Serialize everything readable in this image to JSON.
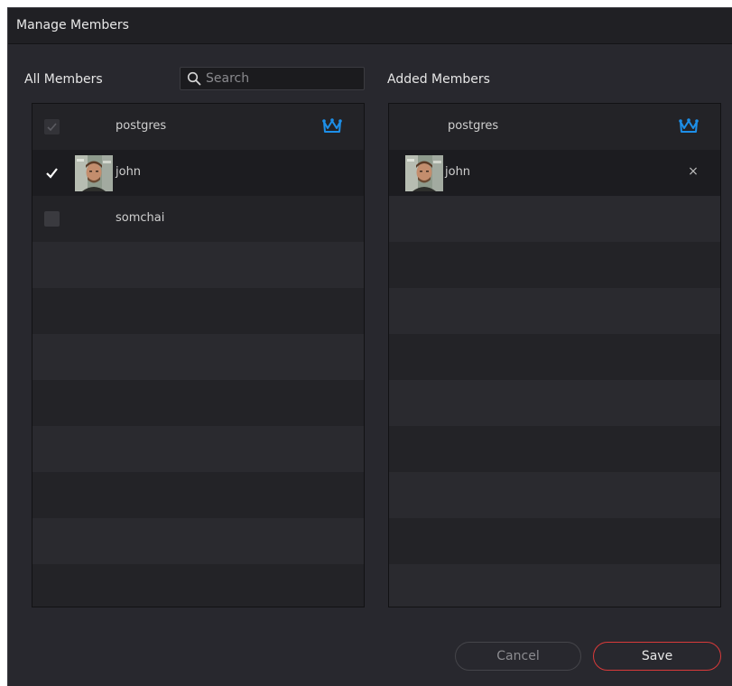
{
  "dialog": {
    "title": "Manage Members"
  },
  "all_members": {
    "label": "All Members",
    "search_placeholder": "Search",
    "rows": [
      {
        "name": "postgres",
        "checked": true,
        "disabled": true,
        "owner": true
      },
      {
        "name": "john",
        "checked": true,
        "disabled": false,
        "owner": false
      },
      {
        "name": "somchai",
        "checked": false,
        "disabled": false,
        "owner": false
      }
    ]
  },
  "added_members": {
    "label": "Added Members",
    "rows": [
      {
        "name": "postgres",
        "owner": true
      },
      {
        "name": "john",
        "removable": true,
        "remove_glyph": "×"
      }
    ]
  },
  "buttons": {
    "cancel": "Cancel",
    "save": "Save"
  },
  "colors": {
    "background": "#28282e",
    "accent_crown": "#1d8fe8",
    "save_border": "#d93a3a"
  }
}
